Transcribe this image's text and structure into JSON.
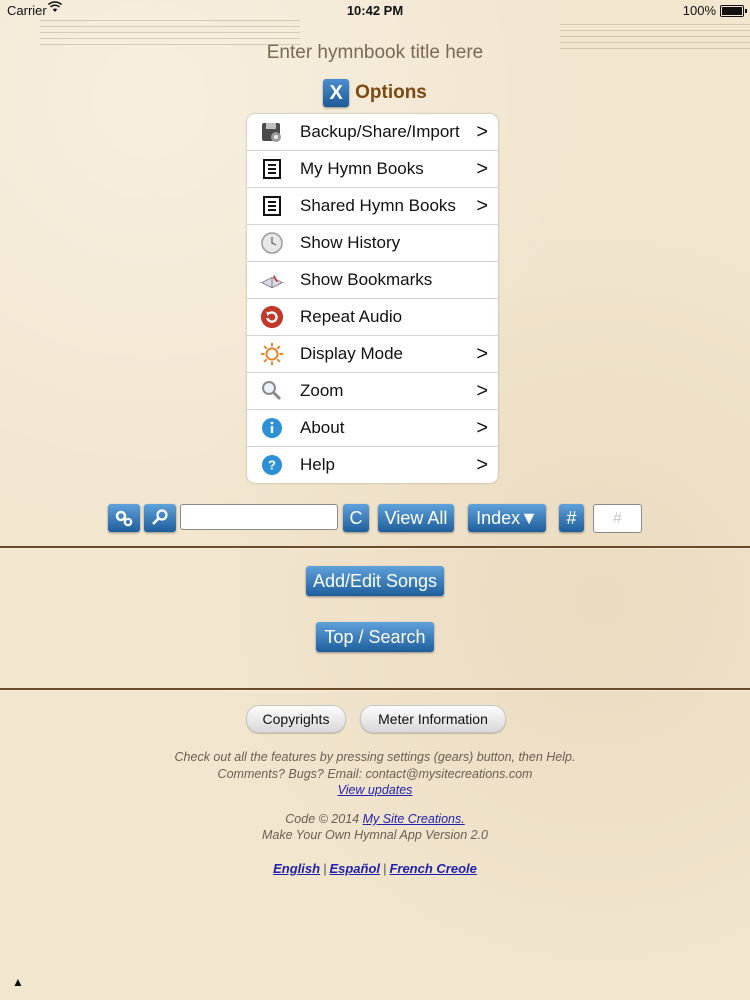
{
  "status_bar": {
    "carrier": "Carrier",
    "time": "10:42 PM",
    "battery": "100%"
  },
  "title_placeholder": "Enter hymnbook title here",
  "options": {
    "close_label": "X",
    "title": "Options"
  },
  "menu": [
    {
      "label": "Backup/Share/Import",
      "chevron": ">",
      "icon": "backup-disk-icon"
    },
    {
      "label": "My Hymn Books",
      "chevron": ">",
      "icon": "document-list-icon"
    },
    {
      "label": "Shared Hymn Books",
      "chevron": ">",
      "icon": "document-list-icon"
    },
    {
      "label": "Show History",
      "chevron": "",
      "icon": "clock-icon"
    },
    {
      "label": "Show Bookmarks",
      "chevron": "",
      "icon": "open-book-icon"
    },
    {
      "label": "Repeat Audio",
      "chevron": "",
      "icon": "repeat-icon"
    },
    {
      "label": "Display Mode",
      "chevron": ">",
      "icon": "sun-icon"
    },
    {
      "label": "Zoom",
      "chevron": ">",
      "icon": "magnifier-icon"
    },
    {
      "label": "About",
      "chevron": ">",
      "icon": "info-icon"
    },
    {
      "label": "Help",
      "chevron": ">",
      "icon": "help-icon"
    }
  ],
  "toolbar": {
    "settings_icon": "gears-icon",
    "search_icon": "search-icon",
    "clear_label": "C",
    "view_all_label": "View All",
    "index_label": "Index▼",
    "hash_label": "#",
    "number_placeholder": "#"
  },
  "add_edit_label": "Add/Edit Songs",
  "top_search_label": "Top / Search",
  "copyrights_label": "Copyrights",
  "meter_label": "Meter Information",
  "info": {
    "line1": "Check out all the features by pressing settings (gears) button, then Help.",
    "line2": "Comments? Bugs? Email: contact@mysitecreations.com",
    "view_updates": "View updates",
    "code_prefix": "Code © 2014 ",
    "company": "My Site Creations.",
    "version": "Make Your Own Hymnal App Version 2.0"
  },
  "languages": [
    "English",
    "Español",
    "French Creole"
  ],
  "bottom_arrow": "▲",
  "colors": {
    "button_blue": "#2a6fb0",
    "background": "#f2e6cf",
    "divider": "#6b4a25",
    "options_title": "#7a4a10"
  }
}
